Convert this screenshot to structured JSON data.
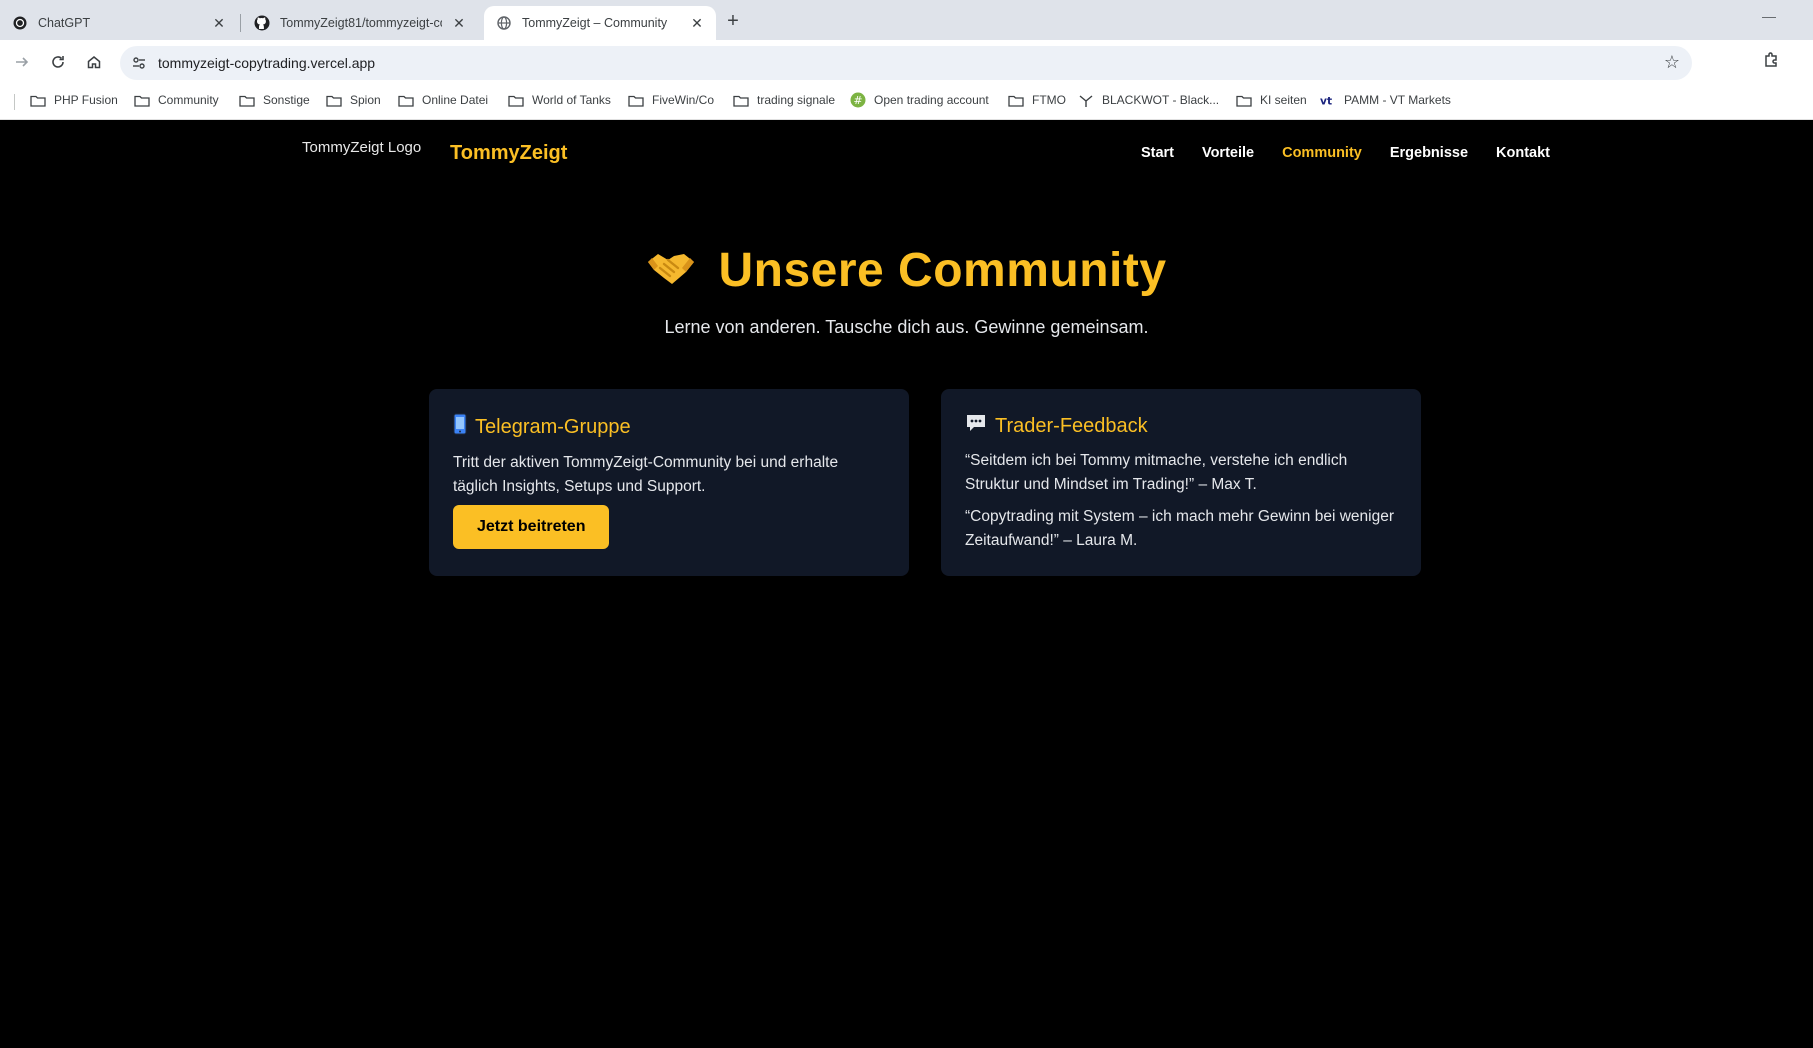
{
  "browser": {
    "tabs": [
      {
        "title": "ChatGPT",
        "favicon": "chatgpt-icon",
        "active": false
      },
      {
        "title": "TommyZeigt81/tommyzeigt-co",
        "favicon": "github-icon",
        "active": false
      },
      {
        "title": "TommyZeigt – Community",
        "favicon": "globe-icon",
        "active": true
      }
    ],
    "url": "tommyzeigt-copytrading.vercel.app",
    "bookmarks": [
      {
        "label": "PHP Fusion",
        "icon": "folder-icon"
      },
      {
        "label": "Community",
        "icon": "folder-icon"
      },
      {
        "label": "Sonstige",
        "icon": "folder-icon"
      },
      {
        "label": "Spion",
        "icon": "folder-icon"
      },
      {
        "label": "Online Datei",
        "icon": "folder-icon"
      },
      {
        "label": "World of Tanks",
        "icon": "folder-icon"
      },
      {
        "label": "FiveWin/Co",
        "icon": "folder-icon"
      },
      {
        "label": "trading signale",
        "icon": "folder-icon"
      },
      {
        "label": "Open trading account",
        "icon": "green-hash-icon"
      },
      {
        "label": "FTMO",
        "icon": "folder-icon"
      },
      {
        "label": "BLACKWOT - Black...",
        "icon": "blackwot-icon"
      },
      {
        "label": "KI seiten",
        "icon": "folder-icon"
      },
      {
        "label": "PAMM - VT Markets",
        "icon": "vt-icon"
      }
    ]
  },
  "site": {
    "logo_alt": "TommyZeigt Logo",
    "brand": "TommyZeigt",
    "nav": [
      "Start",
      "Vorteile",
      "Community",
      "Ergebnisse",
      "Kontakt"
    ],
    "active_nav": "Community"
  },
  "hero": {
    "emoji": "handshake-icon",
    "title": "Unsere Community",
    "subtitle": "Lerne von anderen. Tausche dich aus. Gewinne gemeinsam."
  },
  "cards": {
    "telegram": {
      "title": "Telegram-Gruppe",
      "icon": "mobile-phone-icon",
      "text": "Tritt der aktiven TommyZeigt-Community bei und erhalte täglich Insights, Setups und Support.",
      "button": "Jetzt beitreten"
    },
    "feedback": {
      "title": "Trader-Feedback",
      "icon": "speech-bubble-icon",
      "quotes": [
        "“Seitdem ich bei Tommy mitmache, verstehe ich endlich Struktur und Mindset im Trading!” – Max T.",
        "“Copytrading mit System – ich mach mehr Gewinn bei weniger Zeitaufwand!” – Laura M."
      ]
    }
  },
  "colors": {
    "accent": "#fbbf24",
    "card_bg": "#111827",
    "page_bg": "#000000"
  }
}
